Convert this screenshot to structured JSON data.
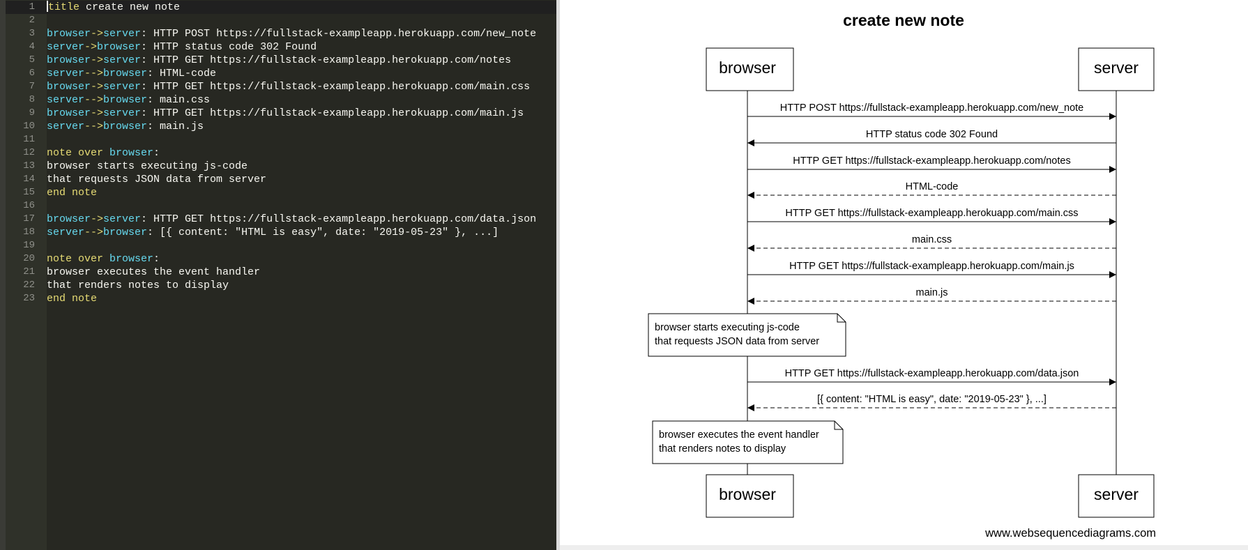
{
  "editor": {
    "lines": [
      {
        "n": "1",
        "tokens": [
          {
            "t": "kw",
            "v": "title"
          },
          {
            "t": "plain",
            "v": " create new note"
          }
        ]
      },
      {
        "n": "2",
        "tokens": []
      },
      {
        "n": "3",
        "tokens": [
          {
            "t": "ident",
            "v": "browser"
          },
          {
            "t": "arrow",
            "v": "->"
          },
          {
            "t": "ident",
            "v": "server"
          },
          {
            "t": "plain",
            "v": ": HTTP POST https://fullstack-exampleapp.herokuapp.com/new_note"
          }
        ]
      },
      {
        "n": "4",
        "tokens": [
          {
            "t": "ident",
            "v": "server"
          },
          {
            "t": "arrow",
            "v": "->"
          },
          {
            "t": "ident",
            "v": "browser"
          },
          {
            "t": "plain",
            "v": ": HTTP status code 302 Found"
          }
        ]
      },
      {
        "n": "5",
        "tokens": [
          {
            "t": "ident",
            "v": "browser"
          },
          {
            "t": "arrow",
            "v": "->"
          },
          {
            "t": "ident",
            "v": "server"
          },
          {
            "t": "plain",
            "v": ": HTTP GET https://fullstack-exampleapp.herokuapp.com/notes"
          }
        ]
      },
      {
        "n": "6",
        "tokens": [
          {
            "t": "ident",
            "v": "server"
          },
          {
            "t": "arrow",
            "v": "-->"
          },
          {
            "t": "ident",
            "v": "browser"
          },
          {
            "t": "plain",
            "v": ": HTML-code"
          }
        ]
      },
      {
        "n": "7",
        "tokens": [
          {
            "t": "ident",
            "v": "browser"
          },
          {
            "t": "arrow",
            "v": "->"
          },
          {
            "t": "ident",
            "v": "server"
          },
          {
            "t": "plain",
            "v": ": HTTP GET https://fullstack-exampleapp.herokuapp.com/main.css"
          }
        ]
      },
      {
        "n": "8",
        "tokens": [
          {
            "t": "ident",
            "v": "server"
          },
          {
            "t": "arrow",
            "v": "-->"
          },
          {
            "t": "ident",
            "v": "browser"
          },
          {
            "t": "plain",
            "v": ": main.css"
          }
        ]
      },
      {
        "n": "9",
        "tokens": [
          {
            "t": "ident",
            "v": "browser"
          },
          {
            "t": "arrow",
            "v": "->"
          },
          {
            "t": "ident",
            "v": "server"
          },
          {
            "t": "plain",
            "v": ": HTTP GET https://fullstack-exampleapp.herokuapp.com/main.js"
          }
        ]
      },
      {
        "n": "10",
        "tokens": [
          {
            "t": "ident",
            "v": "server"
          },
          {
            "t": "arrow",
            "v": "-->"
          },
          {
            "t": "ident",
            "v": "browser"
          },
          {
            "t": "plain",
            "v": ": main.js"
          }
        ]
      },
      {
        "n": "11",
        "tokens": []
      },
      {
        "n": "12",
        "tokens": [
          {
            "t": "kw",
            "v": "note over"
          },
          {
            "t": "plain",
            "v": " "
          },
          {
            "t": "ident",
            "v": "browser"
          },
          {
            "t": "plain",
            "v": ":"
          }
        ]
      },
      {
        "n": "13",
        "tokens": [
          {
            "t": "plain",
            "v": "browser starts executing js-code"
          }
        ]
      },
      {
        "n": "14",
        "tokens": [
          {
            "t": "plain",
            "v": "that requests JSON data from server"
          }
        ]
      },
      {
        "n": "15",
        "tokens": [
          {
            "t": "kw",
            "v": "end note"
          }
        ]
      },
      {
        "n": "16",
        "tokens": []
      },
      {
        "n": "17",
        "tokens": [
          {
            "t": "ident",
            "v": "browser"
          },
          {
            "t": "arrow",
            "v": "->"
          },
          {
            "t": "ident",
            "v": "server"
          },
          {
            "t": "plain",
            "v": ": HTTP GET https://fullstack-exampleapp.herokuapp.com/data.json"
          }
        ]
      },
      {
        "n": "18",
        "tokens": [
          {
            "t": "ident",
            "v": "server"
          },
          {
            "t": "arrow",
            "v": "-->"
          },
          {
            "t": "ident",
            "v": "browser"
          },
          {
            "t": "plain",
            "v": ": [{ content: \"HTML is easy\", date: \"2019-05-23\" }, ...]"
          }
        ]
      },
      {
        "n": "19",
        "tokens": []
      },
      {
        "n": "20",
        "tokens": [
          {
            "t": "kw",
            "v": "note over"
          },
          {
            "t": "plain",
            "v": " "
          },
          {
            "t": "ident",
            "v": "browser"
          },
          {
            "t": "plain",
            "v": ":"
          }
        ]
      },
      {
        "n": "21",
        "tokens": [
          {
            "t": "plain",
            "v": "browser executes the event handler"
          }
        ]
      },
      {
        "n": "22",
        "tokens": [
          {
            "t": "plain",
            "v": "that renders notes to display"
          }
        ]
      },
      {
        "n": "23",
        "tokens": [
          {
            "t": "kw",
            "v": "end note"
          }
        ]
      }
    ]
  },
  "diagram": {
    "title": "create new note",
    "participants": [
      "browser",
      "server"
    ],
    "messages": [
      {
        "from": "browser",
        "to": "server",
        "dashed": false,
        "label": "HTTP POST https://fullstack-exampleapp.herokuapp.com/new_note"
      },
      {
        "from": "server",
        "to": "browser",
        "dashed": false,
        "label": "HTTP status code 302 Found"
      },
      {
        "from": "browser",
        "to": "server",
        "dashed": false,
        "label": "HTTP GET https://fullstack-exampleapp.herokuapp.com/notes"
      },
      {
        "from": "server",
        "to": "browser",
        "dashed": true,
        "label": "HTML-code"
      },
      {
        "from": "browser",
        "to": "server",
        "dashed": false,
        "label": "HTTP GET https://fullstack-exampleapp.herokuapp.com/main.css"
      },
      {
        "from": "server",
        "to": "browser",
        "dashed": true,
        "label": "main.css"
      },
      {
        "from": "browser",
        "to": "server",
        "dashed": false,
        "label": "HTTP GET https://fullstack-exampleapp.herokuapp.com/main.js"
      },
      {
        "from": "server",
        "to": "browser",
        "dashed": true,
        "label": "main.js"
      },
      {
        "note": true,
        "over": "browser",
        "lines": [
          "browser starts executing js-code",
          "that requests JSON data from server"
        ]
      },
      {
        "from": "browser",
        "to": "server",
        "dashed": false,
        "label": "HTTP GET https://fullstack-exampleapp.herokuapp.com/data.json"
      },
      {
        "from": "server",
        "to": "browser",
        "dashed": true,
        "label": "[{ content: \"HTML is easy\", date: \"2019-05-23\" }, ...]"
      },
      {
        "note": true,
        "over": "browser",
        "lines": [
          "browser executes the event handler",
          "that renders notes to display"
        ]
      }
    ],
    "footer": "www.websequencediagrams.com"
  }
}
